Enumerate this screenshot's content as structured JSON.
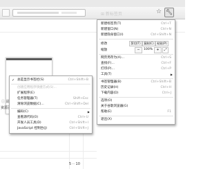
{
  "toolbar": {
    "address_text": "⊞ 新标签页",
    "star_icon": "star-icon",
    "wrench_icon": "wrench-icon"
  },
  "main_menu": {
    "new_tab": {
      "label": "新建标签页(T)",
      "shortcut": "Ctrl+T"
    },
    "new_window": {
      "label": "新建窗口(N)",
      "shortcut": "Ctrl+N"
    },
    "new_incognito": {
      "label": "新建隐身窗口(I)",
      "shortcut": "Ctrl+Shift+N"
    },
    "edit": {
      "label": "修改",
      "cut": "剪切(T)",
      "copy": "复制(C)",
      "paste": "粘贴(P)"
    },
    "zoom": {
      "label": "缩放",
      "minus": "−",
      "value": "100%",
      "plus": "+"
    },
    "save_as": {
      "label": "网页另存为(A)...",
      "shortcut": "Ctrl+S"
    },
    "find": {
      "label": "查找(F)...",
      "shortcut": "Ctrl+F"
    },
    "print": {
      "label": "打印(P)...",
      "shortcut": "Ctrl+P"
    },
    "tools": {
      "label": "工具(T)"
    },
    "bookmarks": {
      "label": "书签管理器(B)",
      "shortcut": "Ctrl+Shift+B"
    },
    "history": {
      "label": "历史记录(H)",
      "shortcut": "Ctrl+H"
    },
    "downloads": {
      "label": "下载内容(D)",
      "shortcut": "Ctrl+J"
    },
    "options": {
      "label": "选项(O)"
    },
    "about": {
      "label": "关于谷歌浏览器(G)"
    },
    "help": {
      "label": "帮助(E)",
      "shortcut": "F1"
    },
    "exit": {
      "label": "退出(X)"
    }
  },
  "sub_menu": {
    "always_show_bookmarks": {
      "label": "总是显示书签栏(S)",
      "shortcut": "Ctrl+Shift+B"
    },
    "create_shortcut": {
      "label": "创建应用程序快捷方式(S)..."
    },
    "extensions": {
      "label": "扩展程序(E)"
    },
    "task_manager": {
      "label": "任务管理器(T)",
      "shortcut": "Shift+Esc"
    },
    "clear_data": {
      "label": "清除浏览数据(C)...",
      "shortcut": "Ctrl+Shift+Del"
    },
    "encoding": {
      "label": "编码(C)"
    },
    "view_source": {
      "label": "查看源代码(O)",
      "shortcut": "Ctrl+U"
    },
    "dev_tools": {
      "label": "开发人员工具(D)",
      "shortcut": "Ctrl+Shift+I"
    },
    "js_console": {
      "label": "JavaScript 控制台(J)",
      "shortcut": "Ctrl+Shift+J"
    }
  },
  "page": {
    "thumb_caption": "ⓘ 最近关闭的标签",
    "cut_text": "资源页",
    "footer_text": "5 ·· 10"
  },
  "colors": {
    "menu_bg": "#ffffff",
    "menu_border": "#a9a9a9",
    "disabled": "#b8b8b8"
  }
}
